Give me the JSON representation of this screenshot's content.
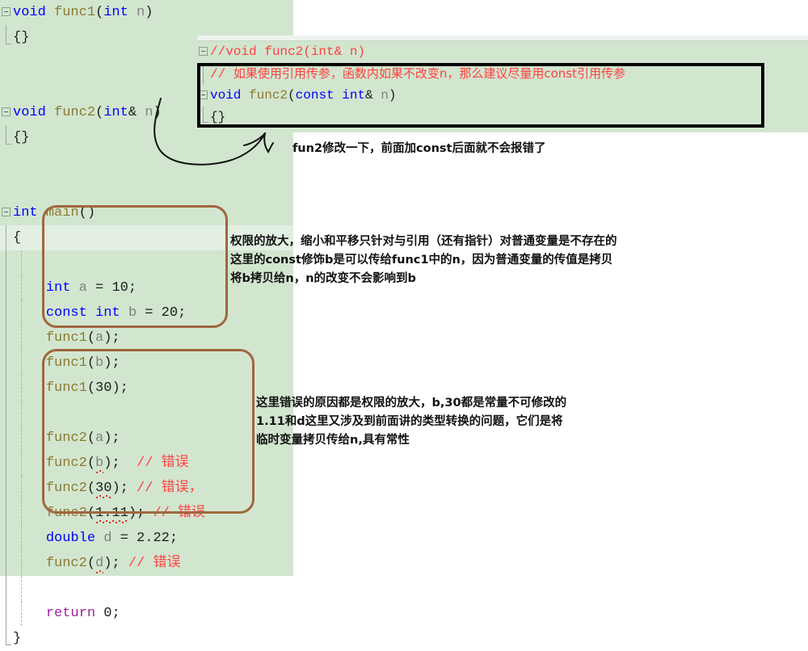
{
  "theme": {
    "editor_background": "#d2e6cf",
    "current_line_background": "#e2efe1",
    "keyword_color": "#0000ff",
    "function_color": "#8c7a33",
    "identifier_color": "#808080",
    "comment_color": "#ff4040",
    "return_keyword_color": "#a020a0",
    "pen_box_color": "#a0663f",
    "inset_border_color": "#000000",
    "error_squiggle_color": "#e03030",
    "page_background": "#ffffff"
  },
  "editor": {
    "lines": [
      {
        "id": "l1",
        "fold": "open",
        "indent": false,
        "highlight": false,
        "tokens": [
          {
            "t": "void",
            "c": "kw"
          },
          {
            "t": " ",
            "c": "punc"
          },
          {
            "t": "func1",
            "c": "fn"
          },
          {
            "t": "(",
            "c": "punc"
          },
          {
            "t": "int",
            "c": "kw"
          },
          {
            "t": " ",
            "c": "punc"
          },
          {
            "t": "n",
            "c": "id"
          },
          {
            "t": ")",
            "c": "punc"
          }
        ]
      },
      {
        "id": "l2",
        "fold": "end",
        "indent": false,
        "highlight": false,
        "tokens": [
          {
            "t": "{}",
            "c": "brace"
          }
        ]
      },
      {
        "id": "l3",
        "fold": "none",
        "indent": false,
        "highlight": false,
        "tokens": []
      },
      {
        "id": "l4",
        "fold": "none",
        "indent": false,
        "highlight": false,
        "tokens": []
      },
      {
        "id": "l5",
        "fold": "open",
        "indent": false,
        "highlight": false,
        "tokens": [
          {
            "t": "void",
            "c": "kw"
          },
          {
            "t": " ",
            "c": "punc"
          },
          {
            "t": "func2",
            "c": "fn"
          },
          {
            "t": "(",
            "c": "punc"
          },
          {
            "t": "int",
            "c": "kw"
          },
          {
            "t": "& ",
            "c": "punc"
          },
          {
            "t": "n",
            "c": "id"
          },
          {
            "t": ")",
            "c": "punc"
          }
        ]
      },
      {
        "id": "l6",
        "fold": "end",
        "indent": false,
        "highlight": false,
        "tokens": [
          {
            "t": "{}",
            "c": "brace"
          }
        ]
      },
      {
        "id": "l7",
        "fold": "none",
        "indent": false,
        "highlight": false,
        "tokens": []
      },
      {
        "id": "l8",
        "fold": "none",
        "indent": false,
        "highlight": false,
        "tokens": []
      },
      {
        "id": "l9",
        "fold": "open",
        "indent": false,
        "highlight": false,
        "tokens": [
          {
            "t": "int",
            "c": "kw"
          },
          {
            "t": " ",
            "c": "punc"
          },
          {
            "t": "main",
            "c": "fn"
          },
          {
            "t": "()",
            "c": "punc"
          }
        ]
      },
      {
        "id": "l10",
        "fold": "bar",
        "indent": false,
        "highlight": true,
        "tokens": [
          {
            "t": "{",
            "c": "brace"
          }
        ]
      },
      {
        "id": "l11",
        "fold": "bar",
        "indent": true,
        "highlight": false,
        "tokens": []
      },
      {
        "id": "l12",
        "fold": "bar",
        "indent": true,
        "highlight": false,
        "tokens": [
          {
            "t": "    ",
            "c": "punc"
          },
          {
            "t": "int",
            "c": "kw"
          },
          {
            "t": " ",
            "c": "punc"
          },
          {
            "t": "a",
            "c": "id"
          },
          {
            "t": " = ",
            "c": "punc"
          },
          {
            "t": "10",
            "c": "num"
          },
          {
            "t": ";",
            "c": "punc"
          }
        ]
      },
      {
        "id": "l13",
        "fold": "bar",
        "indent": true,
        "highlight": false,
        "tokens": [
          {
            "t": "    ",
            "c": "punc"
          },
          {
            "t": "const",
            "c": "kw"
          },
          {
            "t": " ",
            "c": "punc"
          },
          {
            "t": "int",
            "c": "kw"
          },
          {
            "t": " ",
            "c": "punc"
          },
          {
            "t": "b",
            "c": "id"
          },
          {
            "t": " = ",
            "c": "punc"
          },
          {
            "t": "20",
            "c": "num"
          },
          {
            "t": ";",
            "c": "punc"
          }
        ]
      },
      {
        "id": "l14",
        "fold": "bar",
        "indent": true,
        "highlight": false,
        "tokens": [
          {
            "t": "    ",
            "c": "punc"
          },
          {
            "t": "func1",
            "c": "fn"
          },
          {
            "t": "(",
            "c": "punc"
          },
          {
            "t": "a",
            "c": "id"
          },
          {
            "t": ");",
            "c": "punc"
          }
        ]
      },
      {
        "id": "l15",
        "fold": "bar",
        "indent": true,
        "highlight": false,
        "tokens": [
          {
            "t": "    ",
            "c": "punc"
          },
          {
            "t": "func1",
            "c": "fn"
          },
          {
            "t": "(",
            "c": "punc"
          },
          {
            "t": "b",
            "c": "id"
          },
          {
            "t": ");",
            "c": "punc"
          }
        ]
      },
      {
        "id": "l16",
        "fold": "bar",
        "indent": true,
        "highlight": false,
        "tokens": [
          {
            "t": "    ",
            "c": "punc"
          },
          {
            "t": "func1",
            "c": "fn"
          },
          {
            "t": "(",
            "c": "punc"
          },
          {
            "t": "30",
            "c": "num"
          },
          {
            "t": ");",
            "c": "punc"
          }
        ]
      },
      {
        "id": "l17",
        "fold": "bar",
        "indent": true,
        "highlight": false,
        "tokens": []
      },
      {
        "id": "l18",
        "fold": "bar",
        "indent": true,
        "highlight": false,
        "tokens": [
          {
            "t": "    ",
            "c": "punc"
          },
          {
            "t": "func2",
            "c": "fn"
          },
          {
            "t": "(",
            "c": "punc"
          },
          {
            "t": "a",
            "c": "id"
          },
          {
            "t": ");",
            "c": "punc"
          }
        ]
      },
      {
        "id": "l19",
        "fold": "bar",
        "indent": true,
        "highlight": false,
        "tokens": [
          {
            "t": "    ",
            "c": "punc"
          },
          {
            "t": "func2",
            "c": "fn"
          },
          {
            "t": "(",
            "c": "punc"
          },
          {
            "t": "b",
            "c": "id",
            "err": true
          },
          {
            "t": ");  ",
            "c": "punc"
          },
          {
            "t": "// 错误",
            "c": "cmt"
          }
        ]
      },
      {
        "id": "l20",
        "fold": "bar",
        "indent": true,
        "highlight": false,
        "tokens": [
          {
            "t": "    ",
            "c": "punc"
          },
          {
            "t": "func2",
            "c": "fn"
          },
          {
            "t": "(",
            "c": "punc"
          },
          {
            "t": "30",
            "c": "num",
            "err": true
          },
          {
            "t": "); ",
            "c": "punc"
          },
          {
            "t": "// 错误，",
            "c": "cmt"
          }
        ]
      },
      {
        "id": "l21",
        "fold": "bar",
        "indent": true,
        "highlight": false,
        "tokens": [
          {
            "t": "    ",
            "c": "punc"
          },
          {
            "t": "func2",
            "c": "fn"
          },
          {
            "t": "(",
            "c": "punc"
          },
          {
            "t": "1.11",
            "c": "num",
            "err": true
          },
          {
            "t": "); ",
            "c": "punc"
          },
          {
            "t": "// 错误",
            "c": "cmt"
          }
        ]
      },
      {
        "id": "l22",
        "fold": "bar",
        "indent": true,
        "highlight": false,
        "tokens": [
          {
            "t": "    ",
            "c": "punc"
          },
          {
            "t": "double",
            "c": "kw"
          },
          {
            "t": " ",
            "c": "punc"
          },
          {
            "t": "d",
            "c": "id"
          },
          {
            "t": " = ",
            "c": "punc"
          },
          {
            "t": "2.22",
            "c": "num"
          },
          {
            "t": ";",
            "c": "punc"
          }
        ]
      },
      {
        "id": "l23",
        "fold": "bar",
        "indent": true,
        "highlight": false,
        "tokens": [
          {
            "t": "    ",
            "c": "punc"
          },
          {
            "t": "func2",
            "c": "fn"
          },
          {
            "t": "(",
            "c": "punc"
          },
          {
            "t": "d",
            "c": "id",
            "err": true
          },
          {
            "t": "); ",
            "c": "punc"
          },
          {
            "t": "// 错误",
            "c": "cmt"
          }
        ]
      },
      {
        "id": "l24",
        "fold": "bar",
        "indent": true,
        "highlight": false,
        "tokens": []
      },
      {
        "id": "l25",
        "fold": "bar",
        "indent": true,
        "highlight": false,
        "tokens": [
          {
            "t": "    ",
            "c": "punc"
          },
          {
            "t": "return",
            "c": "ret"
          },
          {
            "t": " ",
            "c": "punc"
          },
          {
            "t": "0",
            "c": "num"
          },
          {
            "t": ";",
            "c": "punc"
          }
        ]
      },
      {
        "id": "l26",
        "fold": "end",
        "indent": false,
        "highlight": false,
        "tokens": [
          {
            "t": "}",
            "c": "brace"
          }
        ]
      }
    ]
  },
  "inset": {
    "lines": [
      {
        "id": "i1",
        "fold": "open",
        "tokens": [
          {
            "t": "//void func2(int& n)",
            "c": "cmt"
          }
        ]
      },
      {
        "id": "i2",
        "fold": "bar",
        "tokens": [
          {
            "t": "// ",
            "c": "cmt"
          },
          {
            "t": "如果使用引用传参，函数内如果不改变n，那么建议尽量用const引用传参",
            "c": "cmt",
            "cn": true
          }
        ]
      },
      {
        "id": "i3",
        "fold": "open",
        "tokens": [
          {
            "t": "void",
            "c": "kw"
          },
          {
            "t": " ",
            "c": "punc"
          },
          {
            "t": "func2",
            "c": "fn"
          },
          {
            "t": "(",
            "c": "punc"
          },
          {
            "t": "const",
            "c": "kw"
          },
          {
            "t": " ",
            "c": "punc"
          },
          {
            "t": "int",
            "c": "kw"
          },
          {
            "t": "& ",
            "c": "punc"
          },
          {
            "t": "n",
            "c": "id"
          },
          {
            "t": ")",
            "c": "punc"
          }
        ]
      },
      {
        "id": "i4",
        "fold": "end",
        "tokens": [
          {
            "t": "{}",
            "c": "brace"
          }
        ]
      }
    ]
  },
  "annotations": {
    "arrow_label": "fun2修改一下，前面加const后面就不会报错了",
    "note_permission": "权限的放大，缩小和平移只针对与引用（还有指针）对普通变量是不存在的\n这里的const修饰b是可以传给func1中的n，因为普通变量的传值是拷贝\n将b拷贝给n，n的改变不会影响到b",
    "note_errors": "这里错误的原因都是权限的放大，b,30都是常量不可修改的\n1.11和d这里又涉及到前面讲的类型转换的问题，它们是将\n临时变量拷贝传给n,具有常性"
  }
}
